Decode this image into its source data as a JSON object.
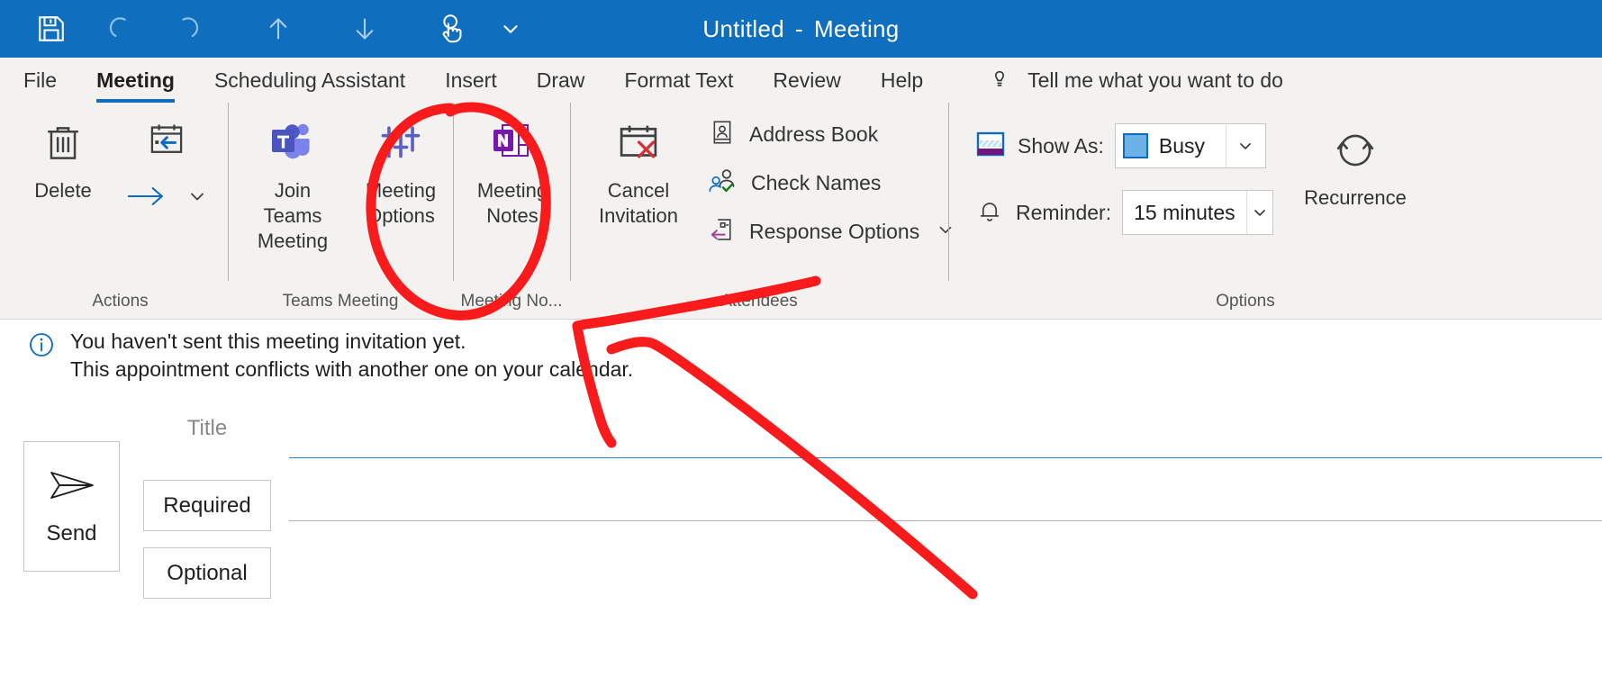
{
  "window": {
    "title_main": "Untitled",
    "title_dash": "-",
    "title_type": "Meeting",
    "accent_color": "#106ebe",
    "ribbon_bg": "#f3f2f1"
  },
  "quick_access": [
    {
      "name": "save",
      "icon": "save-icon"
    },
    {
      "name": "undo",
      "icon": "undo-icon"
    },
    {
      "name": "redo",
      "icon": "redo-icon"
    },
    {
      "name": "previous-item",
      "icon": "arrow-up-icon"
    },
    {
      "name": "next-item",
      "icon": "arrow-down-icon"
    },
    {
      "name": "touch-mode",
      "icon": "touch-hand-icon"
    },
    {
      "name": "customize-qat",
      "icon": "chevron-down-icon"
    }
  ],
  "tabs": [
    {
      "label": "File",
      "active": false
    },
    {
      "label": "Meeting",
      "active": true
    },
    {
      "label": "Scheduling Assistant",
      "active": false
    },
    {
      "label": "Insert",
      "active": false
    },
    {
      "label": "Draw",
      "active": false
    },
    {
      "label": "Format Text",
      "active": false
    },
    {
      "label": "Review",
      "active": false
    },
    {
      "label": "Help",
      "active": false
    }
  ],
  "tell_me": {
    "icon": "lightbulb-icon",
    "label": "Tell me what you want to do"
  },
  "ribbon": {
    "groups": [
      {
        "label": "Actions",
        "buttons": [
          {
            "label": "Delete",
            "icon": "trash-icon"
          },
          {
            "label": "",
            "icon": "forward-calendar-icon"
          },
          {
            "label": "",
            "icon": "forward-arrow-icon"
          },
          {
            "label": "",
            "icon": "chevron-down-icon"
          }
        ]
      },
      {
        "label": "Teams Meeting",
        "buttons": [
          {
            "label": "Join Teams\nMeeting",
            "icon": "teams-logo-icon"
          },
          {
            "label": "Meeting\nOptions",
            "icon": "sliders-icon"
          }
        ]
      },
      {
        "label": "Meeting No...",
        "buttons": [
          {
            "label": "Meeting\nNotes",
            "icon": "onenote-icon"
          }
        ]
      },
      {
        "label": "Attendees",
        "buttons": [
          {
            "label": "Cancel\nInvitation",
            "icon": "calendar-cancel-icon"
          },
          {
            "label": "Address Book",
            "icon": "address-book-icon"
          },
          {
            "label": "Check Names",
            "icon": "check-names-icon"
          },
          {
            "label": "Response Options",
            "icon": "response-options-icon"
          }
        ]
      },
      {
        "label": "Options",
        "show_as_label": "Show As:",
        "show_as_value": "Busy",
        "show_as_swatch": "#6cb2e8",
        "reminder_label": "Reminder:",
        "reminder_value": "15 minutes",
        "recurrence_label": "Recurrence"
      }
    ]
  },
  "info_bar": {
    "icon": "info-icon",
    "line1": "You haven't sent this meeting invitation yet.",
    "line2": "This appointment conflicts with another one on your calendar."
  },
  "form": {
    "send_label": "Send",
    "send_icon": "paper-plane-icon",
    "title_placeholder": "Title",
    "required_label": "Required",
    "optional_label": "Optional"
  },
  "annotation": {
    "color": "#f91b1b",
    "ellipse_target": "Meeting Options",
    "shapes": [
      "ellipse-highlight",
      "pointer-arrow"
    ]
  }
}
